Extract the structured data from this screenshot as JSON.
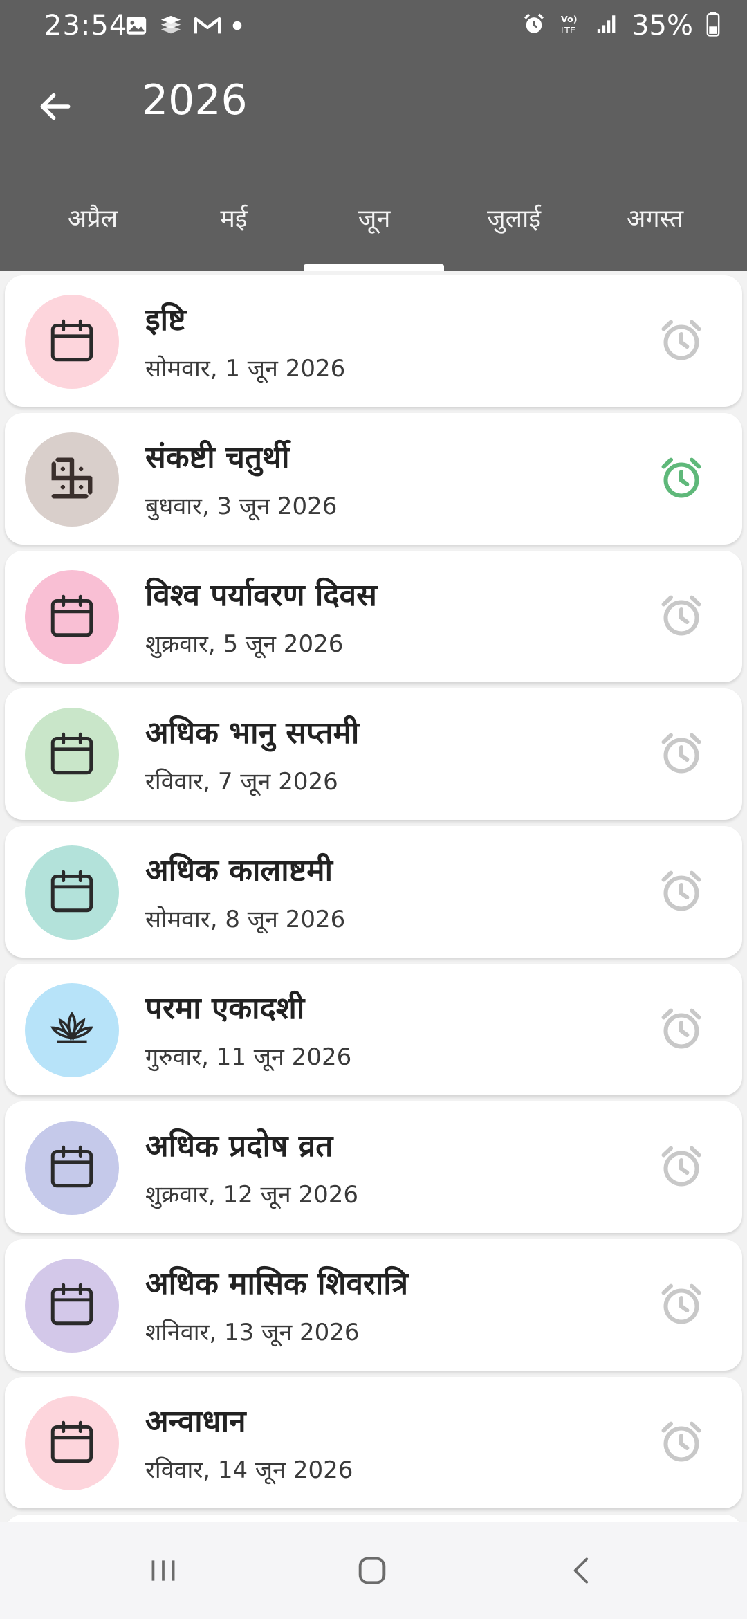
{
  "status_bar": {
    "time": "23:54",
    "battery": "35%"
  },
  "app_bar": {
    "title": "2026"
  },
  "tabs": [
    {
      "label": "अप्रैल"
    },
    {
      "label": "मई"
    },
    {
      "label": "जून",
      "selected": true
    },
    {
      "label": "जुलाई"
    },
    {
      "label": "अगस्त"
    }
  ],
  "events": [
    {
      "title": "इष्टि",
      "date": "सोमवार, 1 जून 2026",
      "icon": "calendar-icon",
      "color": "#fdd5dc",
      "alarm_on": false
    },
    {
      "title": "संकष्टी चतुर्थी",
      "date": "बुधवार, 3 जून 2026",
      "icon": "swastik-icon",
      "color": "#d9cfcb",
      "alarm_on": true
    },
    {
      "title": "विश्व पर्यावरण दिवस",
      "date": "शुक्रवार, 5 जून 2026",
      "icon": "calendar-icon",
      "color": "#f9bfd4",
      "alarm_on": false
    },
    {
      "title": "अधिक भानु सप्तमी",
      "date": "रविवार, 7 जून 2026",
      "icon": "calendar-icon",
      "color": "#c9e6c9",
      "alarm_on": false
    },
    {
      "title": "अधिक कालाष्टमी",
      "date": "सोमवार, 8 जून 2026",
      "icon": "calendar-icon",
      "color": "#b3e2da",
      "alarm_on": false
    },
    {
      "title": "परमा एकादशी",
      "date": "गुरुवार, 11 जून 2026",
      "icon": "lotus-icon",
      "color": "#b7e3f9",
      "alarm_on": false
    },
    {
      "title": "अधिक प्रदोष व्रत",
      "date": "शुक्रवार, 12 जून 2026",
      "icon": "calendar-icon",
      "color": "#c5c9ea",
      "alarm_on": false
    },
    {
      "title": "अधिक मासिक शिवरात्रि",
      "date": "शनिवार, 13 जून 2026",
      "icon": "calendar-icon",
      "color": "#d3c8e9",
      "alarm_on": false
    },
    {
      "title": "अन्वाधान",
      "date": "रविवार, 14 जून 2026",
      "icon": "calendar-icon",
      "color": "#fdd5dc",
      "alarm_on": false
    }
  ],
  "colors": {
    "header_bg": "#5f5f5f",
    "alarm_on": "#5fb87a",
    "alarm_off": "#c8c8c8",
    "list_bg": "#f2f2f2"
  }
}
